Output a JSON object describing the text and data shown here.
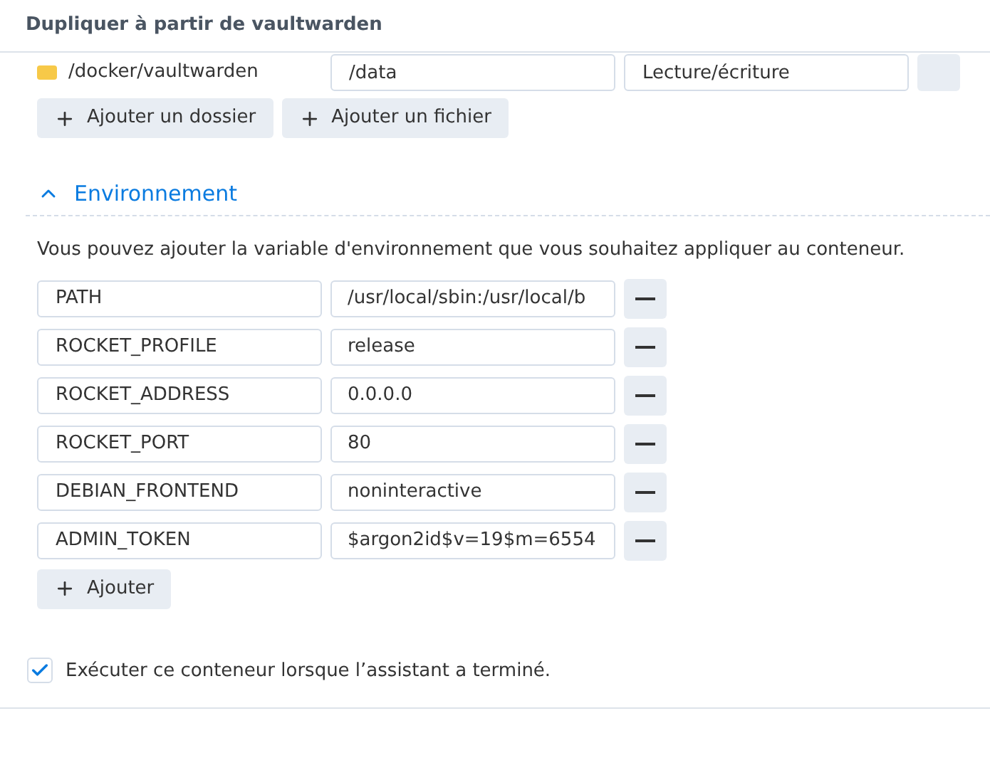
{
  "window": {
    "title": "Dupliquer à partir de vaultwarden"
  },
  "volumes": {
    "rows": [
      {
        "folder": "/docker/vaultwarden",
        "mount_path": "/data",
        "mode": "Lecture/écriture"
      }
    ],
    "buttons": [
      "Ajouter un dossier",
      "Ajouter un fichier"
    ]
  },
  "environment": {
    "title": "Environnement",
    "expanded": true,
    "description": "Vous pouvez ajouter la variable d'environnement que vous souhaitez appliquer au conteneur.",
    "variables": [
      {
        "name": "PATH",
        "value": "/usr/local/sbin:/usr/local/b"
      },
      {
        "name": "ROCKET_PROFILE",
        "value": "release"
      },
      {
        "name": "ROCKET_ADDRESS",
        "value": "0.0.0.0"
      },
      {
        "name": "ROCKET_PORT",
        "value": "80"
      },
      {
        "name": "DEBIAN_FRONTEND",
        "value": "noninteractive"
      },
      {
        "name": "ADMIN_TOKEN",
        "value": "$argon2id$v=19$m=6554"
      }
    ],
    "add_button": "Ajouter"
  },
  "run_after": {
    "label": "Exécuter ce conteneur lorsque l’assistant a terminé.",
    "checked": true
  }
}
